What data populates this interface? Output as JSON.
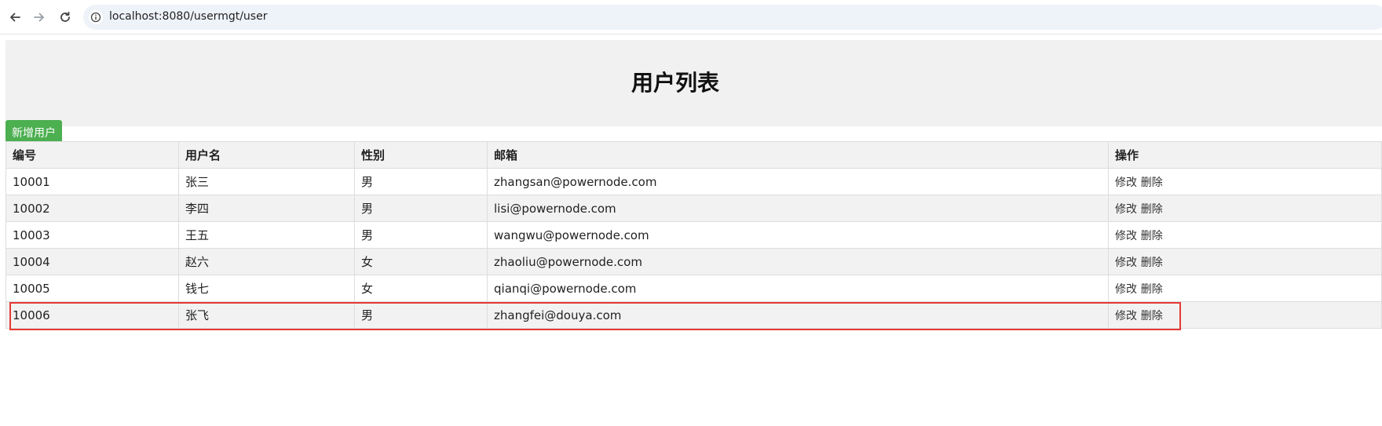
{
  "browser": {
    "url": "localhost:8080/usermgt/user"
  },
  "page": {
    "title": "用户列表",
    "add_button": "新增用户"
  },
  "table": {
    "headers": [
      "编号",
      "用户名",
      "性别",
      "邮箱",
      "操作"
    ],
    "rows": [
      {
        "id": "10001",
        "name": "张三",
        "sex": "男",
        "email": "zhangsan@powernode.com",
        "edit": "修改",
        "delete": "删除"
      },
      {
        "id": "10002",
        "name": "李四",
        "sex": "男",
        "email": "lisi@powernode.com",
        "edit": "修改",
        "delete": "删除"
      },
      {
        "id": "10003",
        "name": "王五",
        "sex": "男",
        "email": "wangwu@powernode.com",
        "edit": "修改",
        "delete": "删除"
      },
      {
        "id": "10004",
        "name": "赵六",
        "sex": "女",
        "email": "zhaoliu@powernode.com",
        "edit": "修改",
        "delete": "删除"
      },
      {
        "id": "10005",
        "name": "钱七",
        "sex": "女",
        "email": "qianqi@powernode.com",
        "edit": "修改",
        "delete": "删除"
      },
      {
        "id": "10006",
        "name": "张飞",
        "sex": "男",
        "email": "zhangfei@douya.com",
        "edit": "修改",
        "delete": "删除"
      }
    ]
  },
  "icons": {
    "back": "back-arrow-icon",
    "forward": "forward-arrow-icon",
    "reload": "reload-icon",
    "site_info": "info-icon"
  },
  "colors": {
    "add_button_bg": "#4caf50",
    "highlight_border": "#e53935",
    "header_band": "#f1f1f1"
  }
}
